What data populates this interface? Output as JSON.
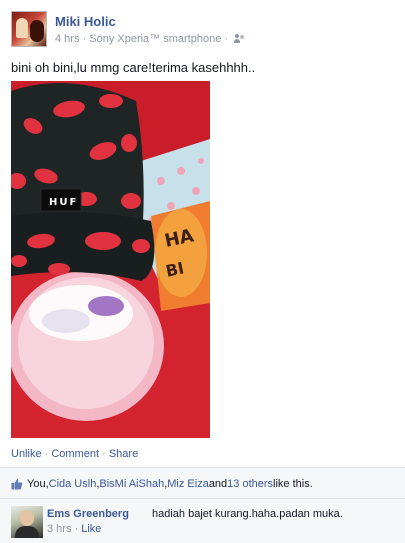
{
  "post": {
    "author": "Miki Holic",
    "time": "4 hrs",
    "separator": " · ",
    "device": "Sony Xperia™ smartphone",
    "text": "bini oh bini,lu mmg care!terima kasehhhh..",
    "photo_caption_cap": "HUF",
    "photo_card_text": "HAPPY BIRTHDAY"
  },
  "actions": {
    "unlike": "Unlike",
    "comment": "Comment",
    "share": "Share",
    "dot": " · "
  },
  "likes": {
    "you": "You, ",
    "person1": "Cida Uslh",
    "comma1": ", ",
    "person2": "BisMi AiShah",
    "comma2": ", ",
    "person3": "Miz Eiza",
    "and": " and ",
    "others": "13 others",
    "suffix": " like this."
  },
  "comment": {
    "author": "Ems Greenberg",
    "text": "hadiah bajet kurang.haha.padan muka.",
    "time": "3 hrs",
    "dot": " · ",
    "like": "Like"
  },
  "colors": {
    "link": "#3b5998",
    "meta": "#9197a3",
    "feedback_bg": "#f6f7f9"
  }
}
